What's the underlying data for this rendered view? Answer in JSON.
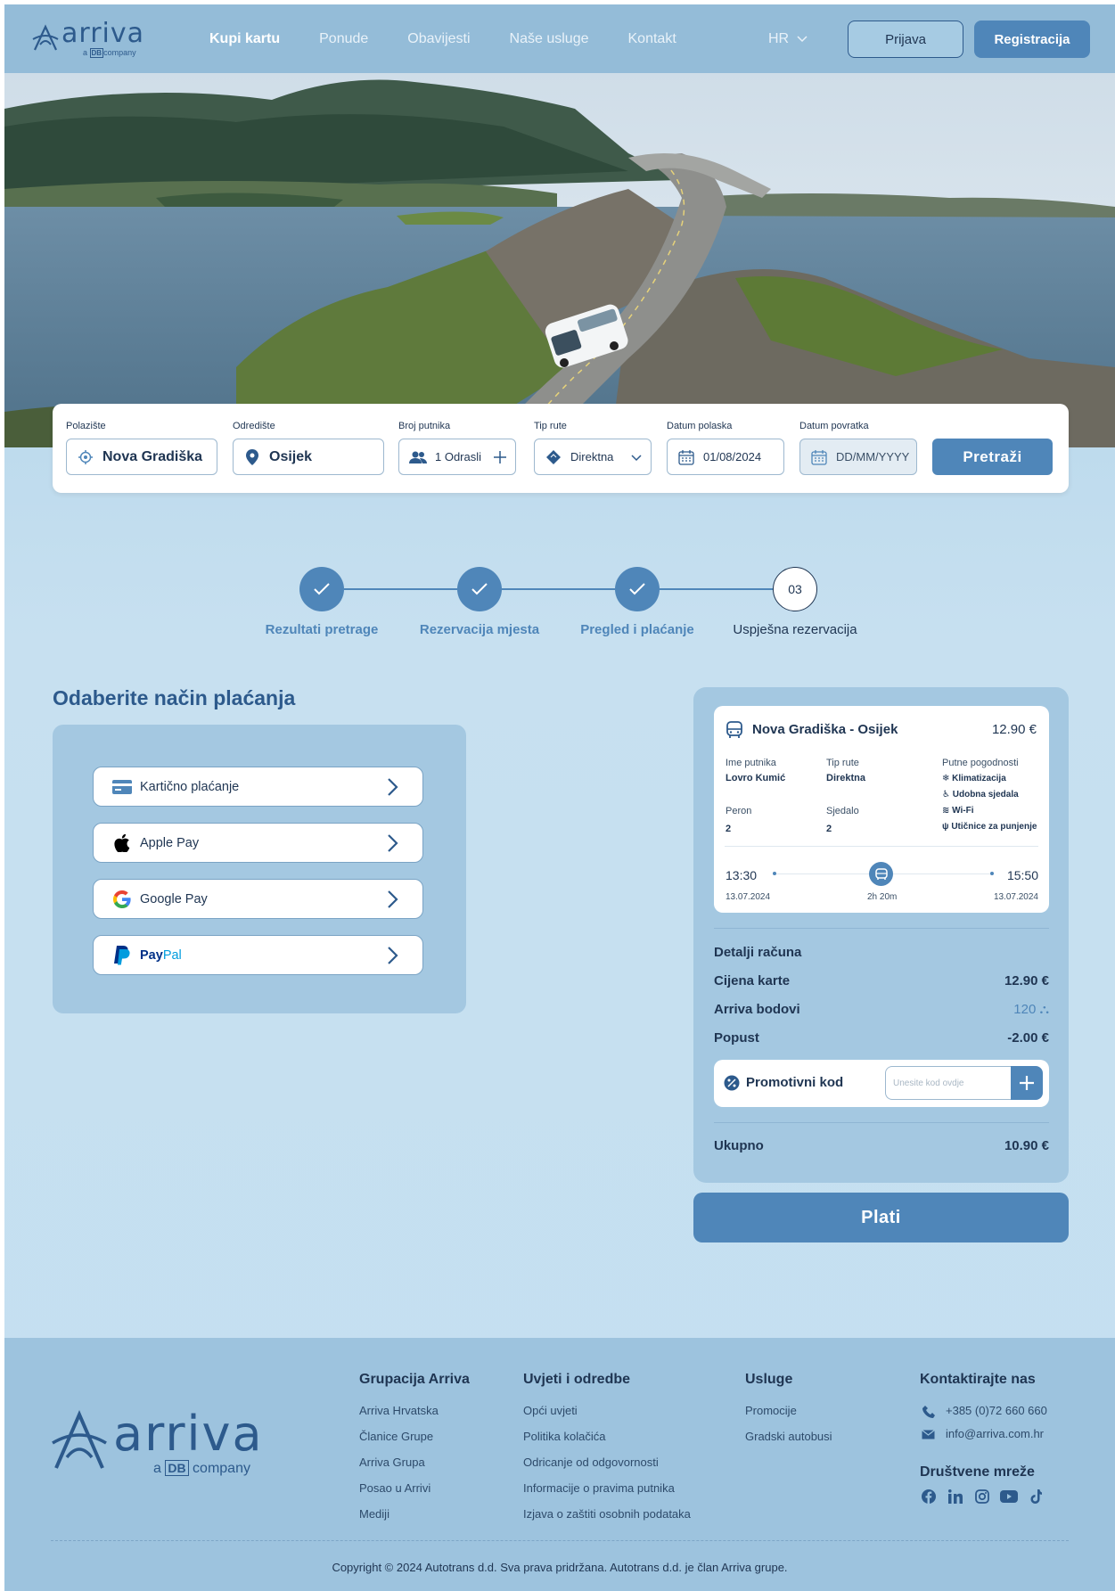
{
  "nav": {
    "logo_text": "arriva",
    "logo_sub_a": "a",
    "logo_sub_db": "DB",
    "logo_sub_company": "company",
    "links": [
      "Kupi kartu",
      "Ponude",
      "Obavijesti",
      "Naše usluge",
      "Kontakt"
    ],
    "language": "HR",
    "login": "Prijava",
    "register": "Registracija"
  },
  "search": {
    "departure_label": "Polazište",
    "departure_value": "Nova Gradiška",
    "destination_label": "Odredište",
    "destination_value": "Osijek",
    "passengers_label": "Broj putnika",
    "passengers_value": "1 Odrasli",
    "route_type_label": "Tip rute",
    "route_type_value": "Direktna",
    "departure_date_label": "Datum polaska",
    "departure_date_value": "01/08/2024",
    "return_date_label": "Datum povratka",
    "return_date_placeholder": "DD/MM/YYYY",
    "search_button": "Pretraži"
  },
  "stepper": {
    "steps": [
      "Rezultati pretrage",
      "Rezervacija mjesta",
      "Pregled i plaćanje",
      "Uspješna rezervacija"
    ],
    "current_number": "03"
  },
  "payment": {
    "title": "Odaberite način plaćanja",
    "options": [
      "Kartično plaćanje",
      "Apple Pay",
      "Google Pay"
    ],
    "paypal_a": "Pay",
    "paypal_b": "Pal"
  },
  "ticket": {
    "route": "Nova Gradiška - Osijek",
    "price": "12.90 €",
    "passenger_label": "Ime putnika",
    "passenger_value": "Lovro Kumić",
    "route_type_label": "Tip rute",
    "route_type_value": "Direktna",
    "amenities_label": "Putne pogodnosti",
    "amenities": [
      "Klimatizacija",
      "Udobna sjedala",
      "Wi-Fi",
      "Utičnice za punjenje"
    ],
    "platform_label": "Peron",
    "platform_value": "2",
    "seat_label": "Sjedalo",
    "seat_value": "2",
    "depart_time": "13:30",
    "depart_date": "13.07.2024",
    "duration": "2h 20m",
    "arrive_time": "15:50",
    "arrive_date": "13.07.2024"
  },
  "bill": {
    "title": "Detalji računa",
    "ticket_price_label": "Cijena karte",
    "ticket_price_value": "12.90 €",
    "points_label": "Arriva bodovi",
    "points_value": "120",
    "discount_label": "Popust",
    "discount_value": "-2.00 €",
    "promo_label": "Promotivni kod",
    "promo_placeholder": "Unesite kod ovdje",
    "total_label": "Ukupno",
    "total_value": "10.90 €",
    "pay_button": "Plati"
  },
  "footer": {
    "col1_title": "Grupacija Arriva",
    "col1_links": [
      "Arriva Hrvatska",
      "Članice Grupe",
      "Arriva Grupa",
      "Posao u Arrivi",
      "Mediji"
    ],
    "col2_title": "Uvjeti i odredbe",
    "col2_links": [
      "Opći uvjeti",
      "Politika kolačića",
      "Odricanje od odgovornosti",
      "Informacije o pravima putnika",
      "Izjava o zaštiti osobnih podataka"
    ],
    "col3_title": "Usluge",
    "col3_links": [
      "Promocije",
      "Gradski autobusi"
    ],
    "col4_title": "Kontaktirajte nas",
    "phone": "+385 (0)72 660 660",
    "email": "info@arriva.com.hr",
    "social_title": "Društvene mreže",
    "social_icons": [
      "facebook-icon",
      "linkedin-icon",
      "instagram-icon",
      "youtube-icon",
      "tiktok-icon"
    ],
    "copyright": "Copyright © 2024 Autotrans d.d. Sva prava pridržana. Autotrans d.d. je član Arriva grupe."
  },
  "colors": {
    "brand": "#4f86b9",
    "dark": "#1f3552",
    "panel": "#a4c8e1",
    "nav_bg": "#94bcd8"
  }
}
